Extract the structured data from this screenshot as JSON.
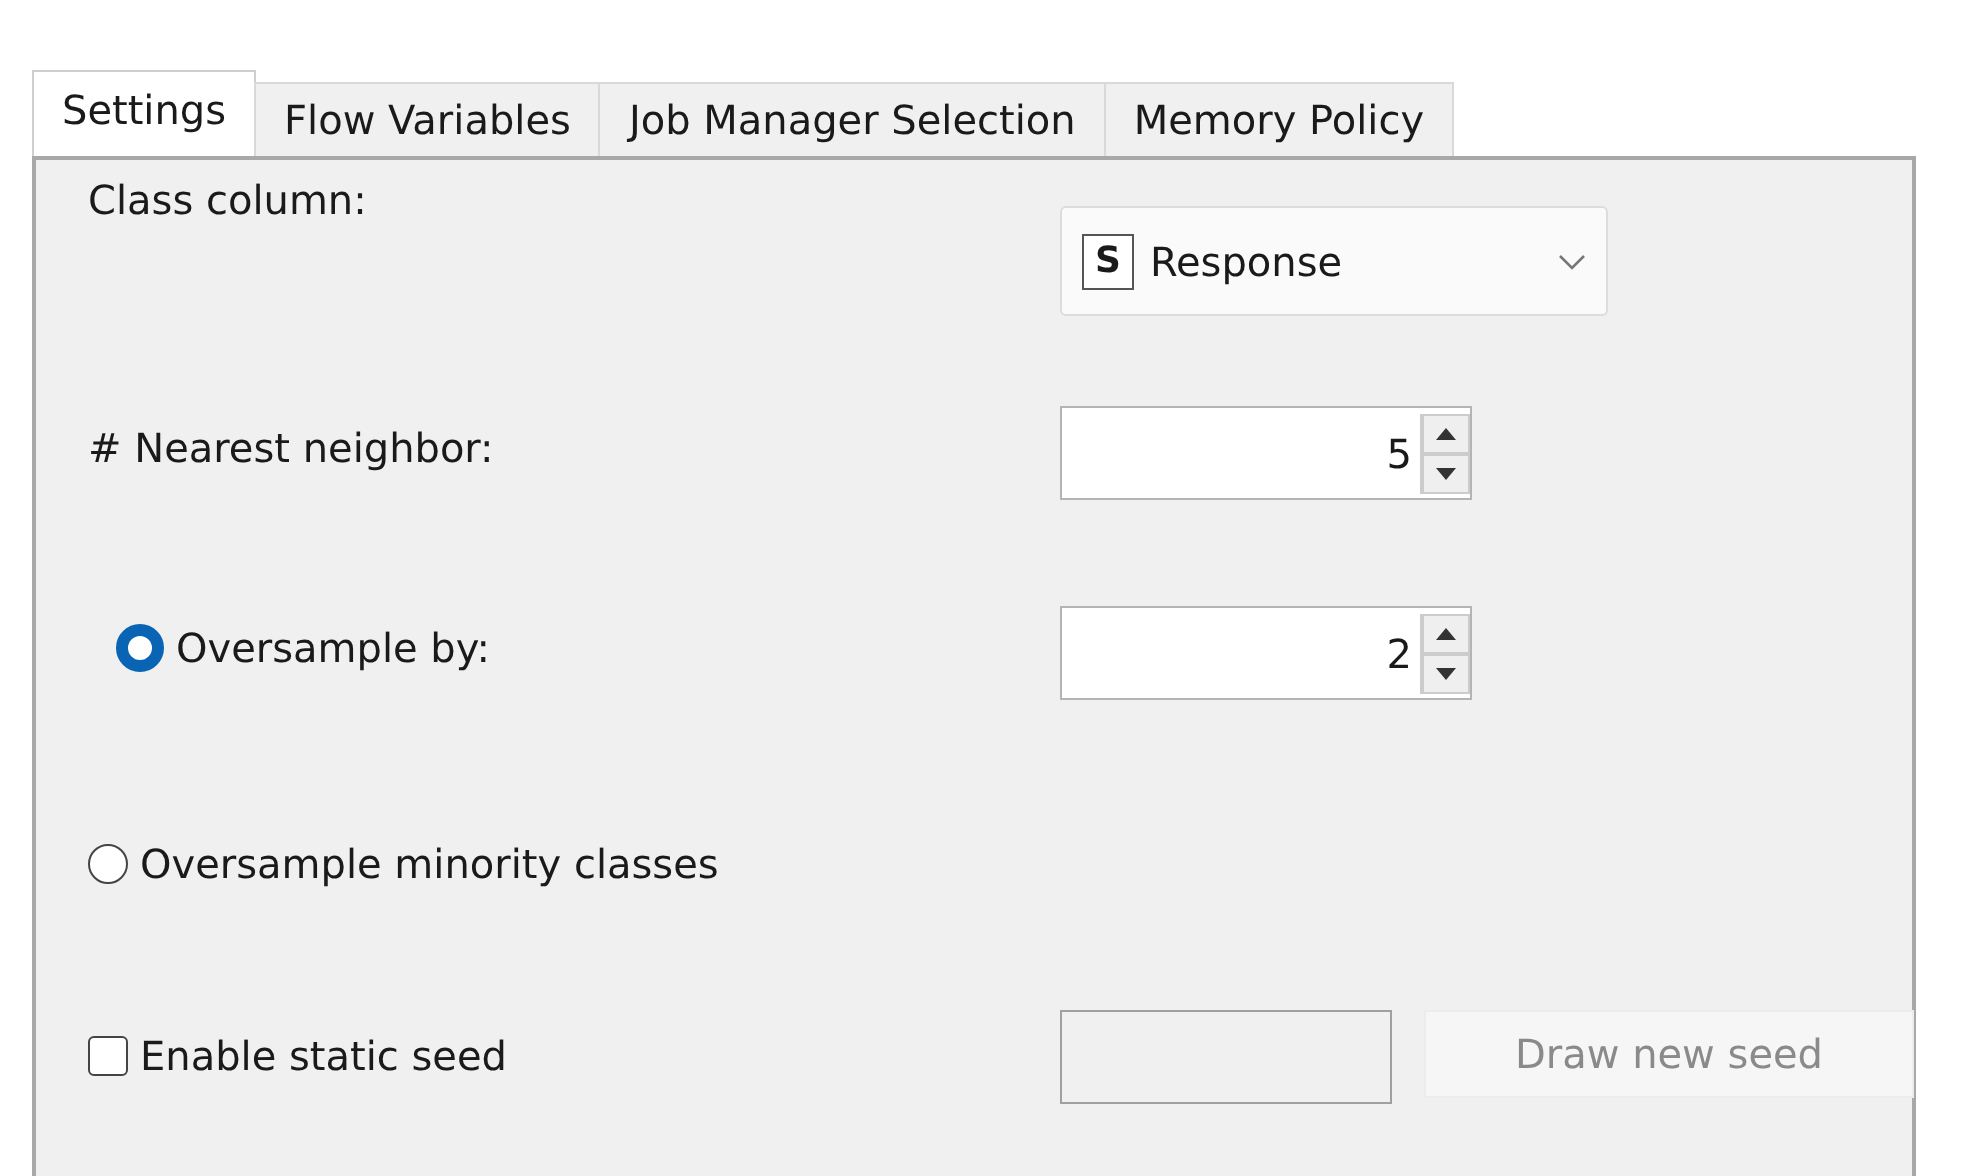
{
  "tabs": [
    {
      "label": "Settings",
      "selected": true
    },
    {
      "label": "Flow Variables",
      "selected": false
    },
    {
      "label": "Job Manager Selection",
      "selected": false
    },
    {
      "label": "Memory Policy",
      "selected": false
    }
  ],
  "settings": [
    {
      "kind": "dropdown",
      "label": "Class column:",
      "badge": "S",
      "value": "Response"
    },
    {
      "kind": "spinner",
      "label": "# Nearest neighbor:",
      "value": "5"
    },
    {
      "kind": "radio-spinner",
      "label": "Oversample by:",
      "selected": true,
      "value": "2"
    },
    {
      "kind": "radio",
      "label": "Oversample minority classes",
      "selected": false
    },
    {
      "kind": "seed",
      "label": "Enable static seed",
      "checked": false,
      "button": "Draw new seed",
      "disabled": true
    }
  ]
}
